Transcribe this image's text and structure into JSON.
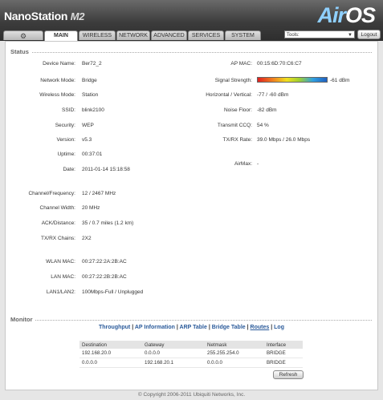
{
  "header": {
    "brand_name": "NanoStation",
    "brand_model": "M2",
    "logo_air": "Air",
    "logo_os": "OS"
  },
  "tabs": [
    {
      "label": "",
      "icon": "ubiquiti-logo-icon"
    },
    {
      "label": "MAIN"
    },
    {
      "label": "WIRELESS"
    },
    {
      "label": "NETWORK"
    },
    {
      "label": "ADVANCED"
    },
    {
      "label": "SERVICES"
    },
    {
      "label": "SYSTEM"
    }
  ],
  "tools": {
    "selected": "Tools:"
  },
  "logout_label": "Logout",
  "status": {
    "title": "Status",
    "left": [
      {
        "label": "Device Name:",
        "value": "Ber72_2"
      },
      {
        "label": "Network Mode:",
        "value": "Bridge"
      },
      {
        "label": "Wireless Mode:",
        "value": "Station"
      },
      {
        "label": "SSID:",
        "value": "blink2100"
      },
      {
        "label": "Security:",
        "value": "WEP"
      },
      {
        "label": "Version:",
        "value": "v5.3"
      },
      {
        "label": "Uptime:",
        "value": "00:37:01"
      },
      {
        "label": "Date:",
        "value": "2011-01-14 15:18:58"
      },
      {
        "label": "Channel/Frequency:",
        "value": "12 / 2467 MHz"
      },
      {
        "label": "Channel Width:",
        "value": "20 MHz"
      },
      {
        "label": "ACK/Distance:",
        "value": "35 / 0.7 miles (1.2 km)"
      },
      {
        "label": "TX/RX Chains:",
        "value": "2X2"
      },
      {
        "label": "WLAN MAC:",
        "value": "00:27:22:2A:2B:AC"
      },
      {
        "label": "LAN MAC:",
        "value": "00:27:22:2B:2B:AC"
      },
      {
        "label": "LAN1/LAN2:",
        "value": "100Mbps-Full / Unplugged"
      }
    ],
    "right": [
      {
        "label": "AP MAC:",
        "value": "00:15:6D:70:C6:C7"
      },
      {
        "label": "Signal Strength:",
        "value": "-61 dBm"
      },
      {
        "label": "Horizontal / Vertical:",
        "value": "-77 / -60 dBm"
      },
      {
        "label": "Noise Floor:",
        "value": "-82 dBm"
      },
      {
        "label": "Transmit CCQ:",
        "value": "54 %"
      },
      {
        "label": "TX/RX Rate:",
        "value": "39.0 Mbps / 26.0 Mbps"
      },
      {
        "label": "AirMax:",
        "value": "-"
      }
    ]
  },
  "monitor": {
    "title": "Monitor",
    "links": [
      "Throughput",
      "AP Information",
      "ARP Table",
      "Bridge Table",
      "Routes",
      "Log"
    ],
    "active_link": "Routes",
    "table": {
      "headers": [
        "Destination",
        "Gateway",
        "Netmask",
        "Interface"
      ],
      "rows": [
        [
          "192.168.20.0",
          "0.0.0.0",
          "255.255.254.0",
          "BRIDGE"
        ],
        [
          "0.0.0.0",
          "192.168.20.1",
          "0.0.0.0",
          "BRIDGE"
        ]
      ]
    },
    "refresh_label": "Refresh"
  },
  "footer": "© Copyright 2006-2011 Ubiquiti Networks, Inc."
}
